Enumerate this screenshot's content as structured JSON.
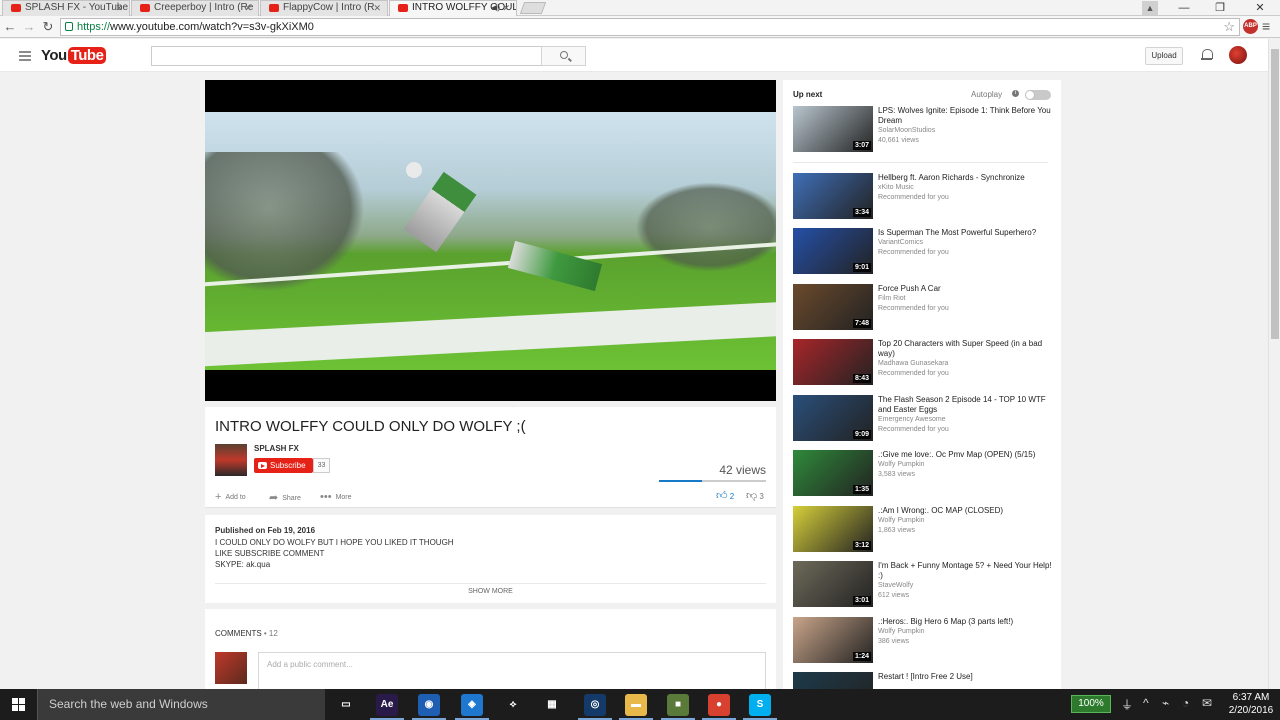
{
  "browser": {
    "tabs": [
      {
        "title": "SPLASH FX - YouTube",
        "active": false
      },
      {
        "title": "Creeperboy | Intro (Re",
        "active": false
      },
      {
        "title": "FlappyCow | Intro (R",
        "active": false
      },
      {
        "title": "INTRO WOLFFY COULD",
        "active": true
      }
    ],
    "url_scheme": "https://",
    "url_rest": "www.youtube.com/watch?v=s3v-gkXiXM0",
    "abp_label": "ABP",
    "window_controls": {
      "minimize": "—",
      "maximize": "❐",
      "close": "✕"
    }
  },
  "youtube": {
    "logo_you": "You",
    "logo_tube": "Tube",
    "upload_label": "Upload"
  },
  "video": {
    "title": "INTRO WOLFFY COULD ONLY DO WOLFY ;(",
    "channel": "SPLASH FX",
    "subscribe_label": "Subscribe",
    "subscriber_count": "33",
    "views": "42 views",
    "like_ratio": 0.4,
    "actions": {
      "add_to": "Add to",
      "share": "Share",
      "more": "More"
    },
    "likes": "2",
    "dislikes": "3"
  },
  "description": {
    "published": "Published on Feb 19, 2016",
    "lines": [
      "I COULD ONLY DO WOLFY BUT I HOPE YOU LIKED IT THOUGH",
      "LIKE SUBSCRIBE COMMENT",
      "SKYPE: ak.qua"
    ],
    "show_more": "SHOW MORE"
  },
  "comments": {
    "heading": "COMMENTS",
    "count": "• 12",
    "placeholder": "Add a public comment..."
  },
  "sidebar": {
    "up_next": "Up next",
    "autoplay": "Autoplay",
    "autoplay_on": false,
    "items": [
      {
        "title": "LPS: Wolves Ignite: Episode 1: Think Before You Dream",
        "channel": "SolarMoonStudios",
        "meta": "40,661 views",
        "duration": "3:07",
        "thumb": "#b9c6cf"
      },
      {
        "title": "Hellberg ft. Aaron Richards - Synchronize",
        "channel": "xKito Music",
        "meta": "Recommended for you",
        "duration": "3:34",
        "thumb": "#3f6fb8"
      },
      {
        "title": "Is Superman The Most Powerful Superhero?",
        "channel": "VariantComics",
        "meta": "Recommended for you",
        "duration": "9:01",
        "thumb": "#2550a8"
      },
      {
        "title": "Force Push A Car",
        "channel": "Film Riot",
        "meta": "Recommended for you",
        "duration": "7:48",
        "thumb": "#6b4a2c"
      },
      {
        "title": "Top 20 Characters with Super Speed (in a bad way)",
        "channel": "Madhawa Gunasekara",
        "meta": "Recommended for you",
        "duration": "8:43",
        "thumb": "#a8262a"
      },
      {
        "title": "The Flash Season 2 Episode 14 - TOP 10 WTF and Easter Eggs",
        "channel": "Emergency Awesome",
        "meta": "Recommended for you",
        "duration": "9:09",
        "thumb": "#2a4f7a"
      },
      {
        "title": ".:Give me love:. Oc Pmv Map (OPEN) (5/15)",
        "channel": "Wolfy Pumpkin",
        "meta": "3,583 views",
        "duration": "1:35",
        "thumb": "#2f8a3a"
      },
      {
        "title": ".:Am I Wrong:. OC MAP (CLOSED)",
        "channel": "Wolfy Pumpkin",
        "meta": "1,863 views",
        "duration": "3:12",
        "thumb": "#d6cf3a"
      },
      {
        "title": "I'm Back + Funny Montage 5? + Need Your Help! :)",
        "channel": "StaveWolfy",
        "meta": "612 views",
        "duration": "3:01",
        "thumb": "#6e6a5a"
      },
      {
        "title": ".:Heros:. Big Hero 6 Map (3 parts left!)",
        "channel": "Wolfy Pumpkin",
        "meta": "386 views",
        "duration": "1:24",
        "thumb": "#c9a58a"
      },
      {
        "title": "Restart ! [Intro Free 2 Use]",
        "channel": "",
        "meta": "",
        "duration": "",
        "thumb": "#1d3a4a"
      }
    ]
  },
  "taskbar": {
    "search_placeholder": "Search the web and Windows",
    "battery": "100%",
    "time": "6:37 AM",
    "date": "2/20/2016",
    "icons": [
      {
        "name": "task-view-icon",
        "label": "▭",
        "color": "#1c1c1c"
      },
      {
        "name": "after-effects-icon",
        "label": "Ae",
        "color": "#2a1a4a"
      },
      {
        "name": "app-blue-icon",
        "label": "◉",
        "color": "#1e5fb4"
      },
      {
        "name": "app-bird-icon",
        "label": "◈",
        "color": "#1e78d0"
      },
      {
        "name": "app-tool-icon",
        "label": "⟡",
        "color": "#1c1c1c"
      },
      {
        "name": "store-icon",
        "label": "▦",
        "color": "#1c1c1c"
      },
      {
        "name": "media-icon",
        "label": "◎",
        "color": "#143a6a"
      },
      {
        "name": "file-explorer-icon",
        "label": "▬",
        "color": "#e8b84a"
      },
      {
        "name": "minecraft-icon",
        "label": "■",
        "color": "#5a7a3a"
      },
      {
        "name": "chrome-icon",
        "label": "●",
        "color": "#d84030"
      },
      {
        "name": "skype-icon",
        "label": "S",
        "color": "#00aff0"
      }
    ],
    "tray": [
      "^",
      "⌁",
      "◔",
      "✉"
    ]
  }
}
